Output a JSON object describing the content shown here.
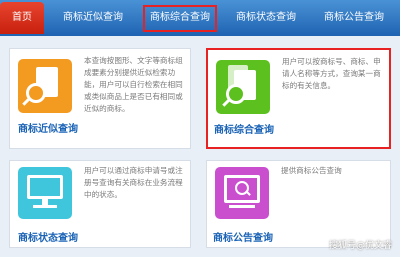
{
  "nav": {
    "home": "首页",
    "items": [
      "商标近似查询",
      "商标综合查询",
      "商标状态查询",
      "商标公告查询"
    ]
  },
  "cards": [
    {
      "title": "商标近似查询",
      "desc": "本查询按图形、文字等商标组成要素分别提供近似检索功能，用户可以自行检索在相同或类似商品上是否已有相同或近似的商标。",
      "icon": "search-document-icon",
      "color": "#f39a21"
    },
    {
      "title": "商标综合查询",
      "desc": "用户可以按商标号、商标、申请人名称等方式，查询某一商标的有关信息。",
      "icon": "search-document-icon",
      "color": "#5cc01e"
    },
    {
      "title": "商标状态查询",
      "desc": "用户可以通过商标申请号或注册号查询有关商标在业务流程中的状态。",
      "icon": "monitor-search-icon",
      "color": "#3fc6dc"
    },
    {
      "title": "商标公告查询",
      "desc": "提供商标公告查询",
      "icon": "board-search-icon",
      "color": "#c94fcf"
    }
  ],
  "watermark": "搜狐号@优文睿"
}
